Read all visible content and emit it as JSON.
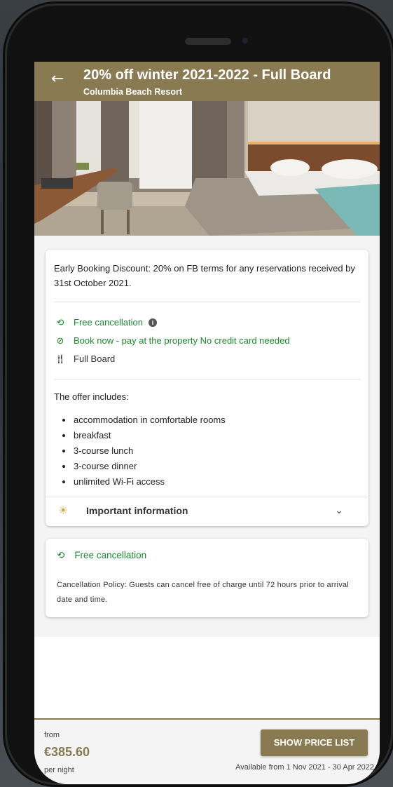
{
  "header": {
    "title": "20% off winter 2021-2022 - Full Board",
    "subtitle": "Columbia Beach Resort",
    "back_icon": "arrow-left-icon"
  },
  "offer": {
    "description": "Early Booking Discount: 20% on FB terms for any reservations received by 31st October 2021.",
    "features": [
      {
        "icon": "history-icon",
        "label": "Free cancellation",
        "color": "#1a8a2e"
      },
      {
        "icon": "check-circle-icon",
        "label": "Book now - pay at the property No credit card needed",
        "color": "#1a8a2e"
      },
      {
        "icon": "cutlery-icon",
        "label": "Full Board",
        "color": "#333333"
      }
    ],
    "includes_title": "The offer includes:",
    "includes": [
      "accommodation in comfortable rooms",
      "breakfast",
      "3-course lunch",
      "3-course dinner",
      "unlimited Wi-Fi access"
    ],
    "important_label": "Important information"
  },
  "cancellation": {
    "title": "Free cancellation",
    "policy": "Cancellation Policy: Guests can cancel free of charge until 72 hours prior to arrival date and time."
  },
  "footer": {
    "from": "from",
    "price": "€385.60",
    "per": "per night",
    "button": "SHOW PRICE LIST",
    "availability": "Available from 1 Nov 2021 - 30 Apr 2022"
  },
  "colors": {
    "brand": "#8a7a52",
    "success": "#1a8a2e"
  }
}
